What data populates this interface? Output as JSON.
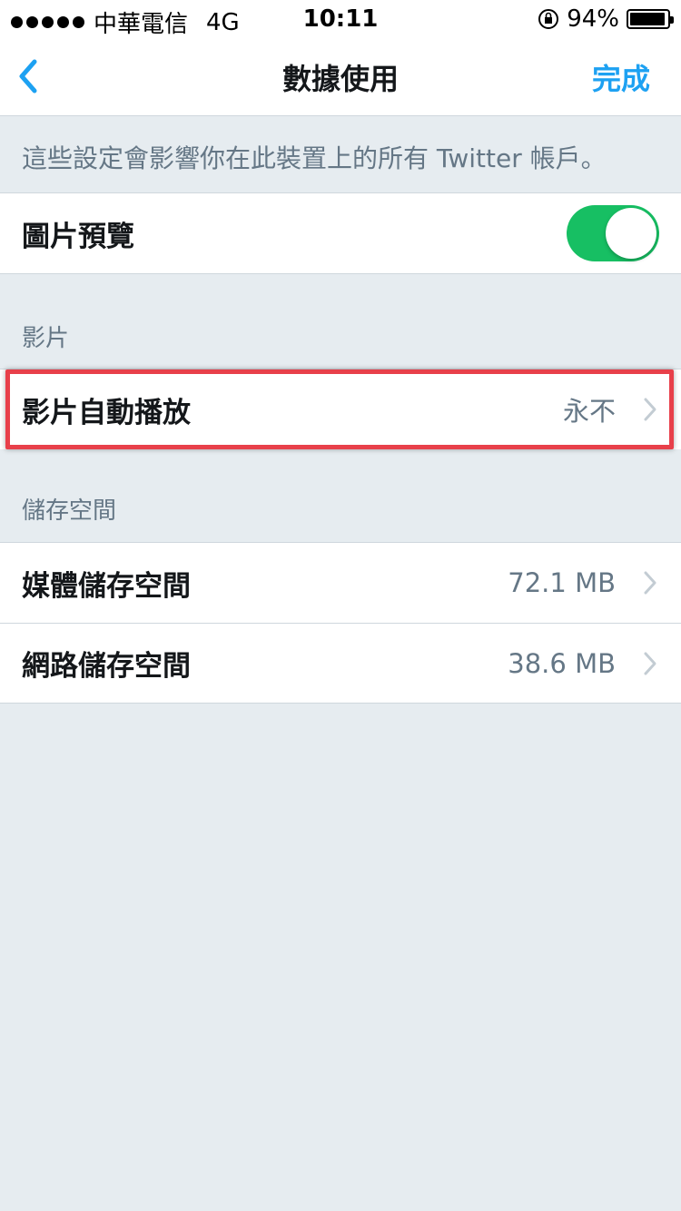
{
  "status_bar": {
    "carrier": "中華電信",
    "network": "4G",
    "time": "10:11",
    "battery_text": "94%",
    "battery_level": 0.94
  },
  "nav": {
    "back_icon": "chevron-left-icon",
    "title": "數據使用",
    "done_label": "完成"
  },
  "info_text": "這些設定會影響你在此裝置上的所有 Twitter 帳戶。",
  "image_preview": {
    "label": "圖片預覽",
    "enabled": true
  },
  "video_section": {
    "header": "影片",
    "autoplay_label": "影片自動播放",
    "autoplay_value": "永不"
  },
  "storage_section": {
    "header": "儲存空間",
    "items": [
      {
        "label": "媒體儲存空間",
        "value": "72.1 MB"
      },
      {
        "label": "網路儲存空間",
        "value": "38.6 MB"
      }
    ]
  },
  "colors": {
    "accent": "#1da1f2",
    "toggle_on": "#17bf63",
    "highlight": "#e8404a",
    "background": "#e6ecf0"
  }
}
